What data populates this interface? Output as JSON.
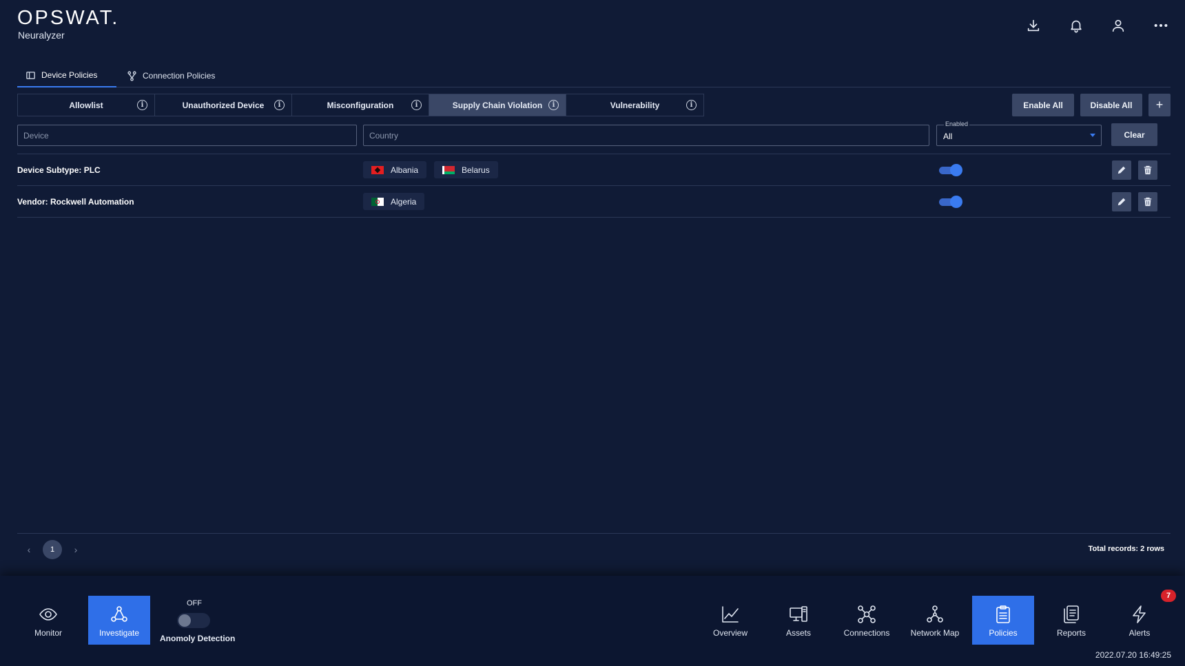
{
  "app": {
    "brand": "OPSWAT.",
    "product": "Neuralyzer"
  },
  "header_icons": [
    "download-icon",
    "bell-icon",
    "user-icon",
    "more-icon"
  ],
  "main_tabs": [
    {
      "label": "Device Policies",
      "icon": "device-policy-icon",
      "active": true
    },
    {
      "label": "Connection Policies",
      "icon": "connection-policy-icon",
      "active": false
    }
  ],
  "sub_tabs": [
    {
      "label": "Allowlist",
      "active": false
    },
    {
      "label": "Unauthorized Device",
      "active": false
    },
    {
      "label": "Misconfiguration",
      "active": false
    },
    {
      "label": "Supply Chain Violation",
      "active": true
    },
    {
      "label": "Vulnerability",
      "active": false
    }
  ],
  "info_glyph": "i",
  "actions": {
    "enable_all": "Enable All",
    "disable_all": "Disable All",
    "add": "+",
    "clear": "Clear"
  },
  "filters": {
    "device_placeholder": "Device",
    "country_placeholder": "Country",
    "enabled_label": "Enabled",
    "enabled_value": "All"
  },
  "rows": [
    {
      "name": "Device Subtype: PLC",
      "countries": [
        "Albania",
        "Belarus"
      ],
      "enabled": true
    },
    {
      "name": "Vendor: Rockwell Automation",
      "countries": [
        "Algeria"
      ],
      "enabled": true
    }
  ],
  "pagination": {
    "prev": "‹",
    "current": "1",
    "next": "›",
    "total": "Total records: 2 rows"
  },
  "bottom_nav": {
    "left": [
      {
        "label": "Monitor",
        "icon": "eye-icon",
        "active": false
      },
      {
        "label": "Investigate",
        "icon": "investigate-icon",
        "active": true
      }
    ],
    "anomaly": {
      "state": "OFF",
      "label": "Anomoly Detection"
    },
    "right": [
      {
        "label": "Overview",
        "icon": "chart-icon",
        "active": false
      },
      {
        "label": "Assets",
        "icon": "assets-icon",
        "active": false
      },
      {
        "label": "Connections",
        "icon": "connections-icon",
        "active": false
      },
      {
        "label": "Network Map",
        "icon": "network-map-icon",
        "active": false
      },
      {
        "label": "Policies",
        "icon": "policies-icon",
        "active": true
      },
      {
        "label": "Reports",
        "icon": "reports-icon",
        "active": false
      },
      {
        "label": "Alerts",
        "icon": "alerts-icon",
        "active": false
      }
    ],
    "alerts_badge": "7"
  },
  "timestamp": "2022.07.20 16:49:25",
  "colors": {
    "background": "#101b36",
    "accent": "#2f6fe8",
    "panel": "#3a4766",
    "badge": "#d7222a"
  }
}
